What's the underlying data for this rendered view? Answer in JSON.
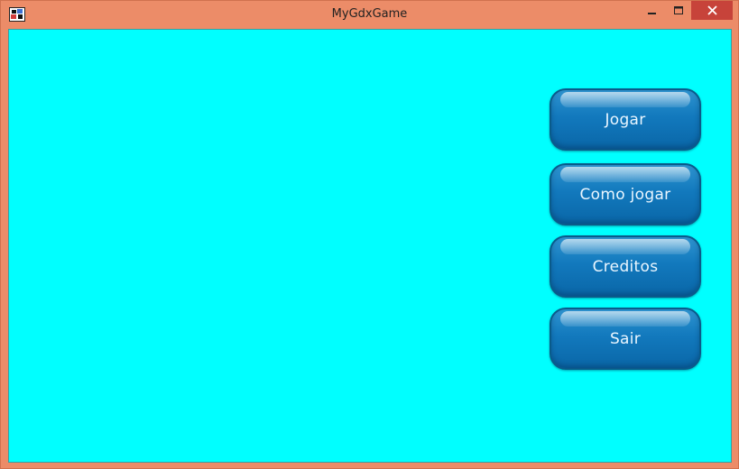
{
  "window": {
    "title": "MyGdxGame",
    "title_bar_color": "#ec8c68",
    "client_background": "#00ffff",
    "controls": {
      "minimize_icon": "minimize-icon",
      "maximize_icon": "maximize-icon",
      "close_icon": "close-icon"
    },
    "app_icon": "libgdx-app-icon"
  },
  "menu": {
    "button_color": "#1279bd",
    "items": [
      {
        "label": "Jogar"
      },
      {
        "label": "Como jogar"
      },
      {
        "label": "Creditos"
      },
      {
        "label": "Sair"
      }
    ]
  }
}
